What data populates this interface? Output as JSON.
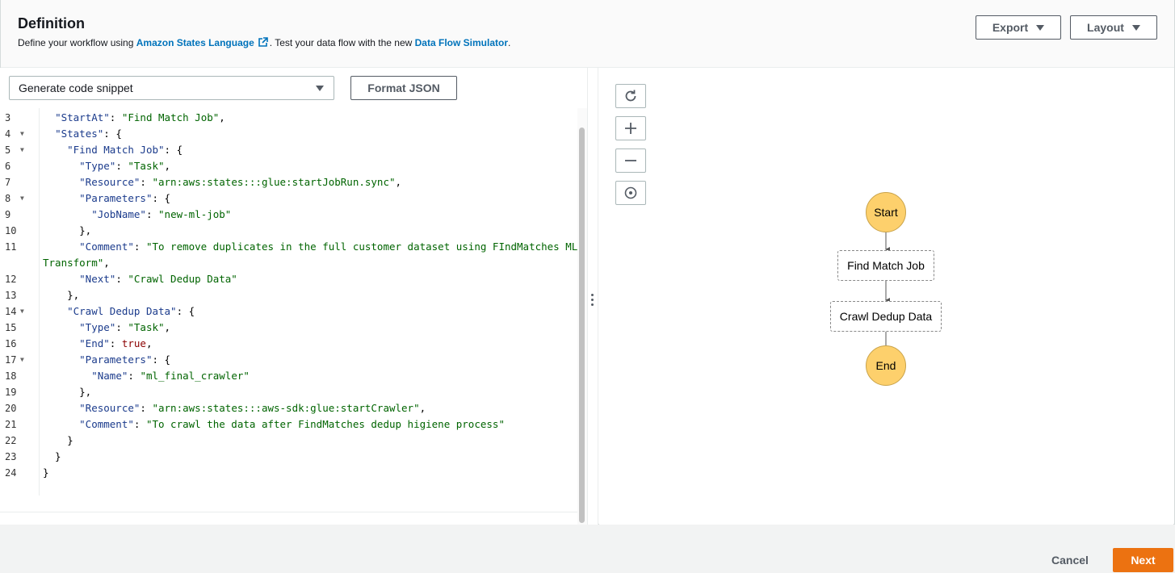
{
  "header": {
    "title": "Definition",
    "subtitle_prefix": "Define your workflow using ",
    "asl_link": "Amazon States Language",
    "subtitle_mid": ". Test your data flow with the new ",
    "simulator_link": "Data Flow Simulator",
    "subtitle_suffix": ".",
    "export_label": "Export",
    "layout_label": "Layout"
  },
  "editor": {
    "snippet_select": "Generate code snippet",
    "format_button": "Format JSON",
    "lines": [
      {
        "n": "3",
        "fold": false,
        "parts": [
          [
            "p",
            "  "
          ],
          [
            "k",
            "\"StartAt\""
          ],
          [
            "p",
            ": "
          ],
          [
            "s",
            "\"Find Match Job\""
          ],
          [
            "p",
            ","
          ]
        ]
      },
      {
        "n": "4",
        "fold": true,
        "parts": [
          [
            "p",
            "  "
          ],
          [
            "k",
            "\"States\""
          ],
          [
            "p",
            ": {"
          ]
        ]
      },
      {
        "n": "5",
        "fold": true,
        "parts": [
          [
            "p",
            "    "
          ],
          [
            "k",
            "\"Find Match Job\""
          ],
          [
            "p",
            ": {"
          ]
        ]
      },
      {
        "n": "6",
        "fold": false,
        "parts": [
          [
            "p",
            "      "
          ],
          [
            "k",
            "\"Type\""
          ],
          [
            "p",
            ": "
          ],
          [
            "s",
            "\"Task\""
          ],
          [
            "p",
            ","
          ]
        ]
      },
      {
        "n": "7",
        "fold": false,
        "parts": [
          [
            "p",
            "      "
          ],
          [
            "k",
            "\"Resource\""
          ],
          [
            "p",
            ": "
          ],
          [
            "s",
            "\"arn:aws:states:::glue:startJobRun.sync\""
          ],
          [
            "p",
            ","
          ]
        ]
      },
      {
        "n": "8",
        "fold": true,
        "parts": [
          [
            "p",
            "      "
          ],
          [
            "k",
            "\"Parameters\""
          ],
          [
            "p",
            ": {"
          ]
        ]
      },
      {
        "n": "9",
        "fold": false,
        "parts": [
          [
            "p",
            "        "
          ],
          [
            "k",
            "\"JobName\""
          ],
          [
            "p",
            ": "
          ],
          [
            "s",
            "\"new-ml-job\""
          ]
        ]
      },
      {
        "n": "10",
        "fold": false,
        "parts": [
          [
            "p",
            "      },"
          ]
        ]
      },
      {
        "n": "11",
        "fold": false,
        "parts": [
          [
            "p",
            "      "
          ],
          [
            "k",
            "\"Comment\""
          ],
          [
            "p",
            ": "
          ],
          [
            "s",
            "\"To remove duplicates in the full customer dataset using FIndMatches ML"
          ]
        ]
      },
      {
        "n": "",
        "fold": false,
        "parts": [
          [
            "s",
            "Transform\""
          ],
          [
            "p",
            ","
          ]
        ]
      },
      {
        "n": "12",
        "fold": false,
        "parts": [
          [
            "p",
            "      "
          ],
          [
            "k",
            "\"Next\""
          ],
          [
            "p",
            ": "
          ],
          [
            "s",
            "\"Crawl Dedup Data\""
          ]
        ]
      },
      {
        "n": "13",
        "fold": false,
        "parts": [
          [
            "p",
            "    },"
          ]
        ]
      },
      {
        "n": "14",
        "fold": true,
        "parts": [
          [
            "p",
            "    "
          ],
          [
            "k",
            "\"Crawl Dedup Data\""
          ],
          [
            "p",
            ": {"
          ]
        ]
      },
      {
        "n": "15",
        "fold": false,
        "parts": [
          [
            "p",
            "      "
          ],
          [
            "k",
            "\"Type\""
          ],
          [
            "p",
            ": "
          ],
          [
            "s",
            "\"Task\""
          ],
          [
            "p",
            ","
          ]
        ]
      },
      {
        "n": "16",
        "fold": false,
        "parts": [
          [
            "p",
            "      "
          ],
          [
            "k",
            "\"End\""
          ],
          [
            "p",
            ": "
          ],
          [
            "b",
            "true"
          ],
          [
            "p",
            ","
          ]
        ]
      },
      {
        "n": "17",
        "fold": true,
        "parts": [
          [
            "p",
            "      "
          ],
          [
            "k",
            "\"Parameters\""
          ],
          [
            "p",
            ": {"
          ]
        ]
      },
      {
        "n": "18",
        "fold": false,
        "parts": [
          [
            "p",
            "        "
          ],
          [
            "k",
            "\"Name\""
          ],
          [
            "p",
            ": "
          ],
          [
            "s",
            "\"ml_final_crawler\""
          ]
        ]
      },
      {
        "n": "19",
        "fold": false,
        "parts": [
          [
            "p",
            "      },"
          ]
        ]
      },
      {
        "n": "20",
        "fold": false,
        "parts": [
          [
            "p",
            "      "
          ],
          [
            "k",
            "\"Resource\""
          ],
          [
            "p",
            ": "
          ],
          [
            "s",
            "\"arn:aws:states:::aws-sdk:glue:startCrawler\""
          ],
          [
            "p",
            ","
          ]
        ]
      },
      {
        "n": "21",
        "fold": false,
        "parts": [
          [
            "p",
            "      "
          ],
          [
            "k",
            "\"Comment\""
          ],
          [
            "p",
            ": "
          ],
          [
            "s",
            "\"To crawl the data after FindMatches dedup higiene process\""
          ]
        ]
      },
      {
        "n": "22",
        "fold": false,
        "parts": [
          [
            "p",
            "    }"
          ]
        ]
      },
      {
        "n": "23",
        "fold": false,
        "parts": [
          [
            "p",
            "  }"
          ]
        ]
      },
      {
        "n": "24",
        "fold": false,
        "parts": [
          [
            "p",
            "}"
          ]
        ]
      }
    ]
  },
  "graph": {
    "tools": [
      "refresh-icon",
      "zoom-in-icon",
      "zoom-out-icon",
      "center-icon"
    ],
    "start": "Start",
    "find_match": "Find Match Job",
    "crawl": "Crawl Dedup Data",
    "end": "End",
    "start_color": "#fdd06c"
  },
  "footer": {
    "cancel": "Cancel",
    "next": "Next",
    "accent": "#ec7211"
  }
}
